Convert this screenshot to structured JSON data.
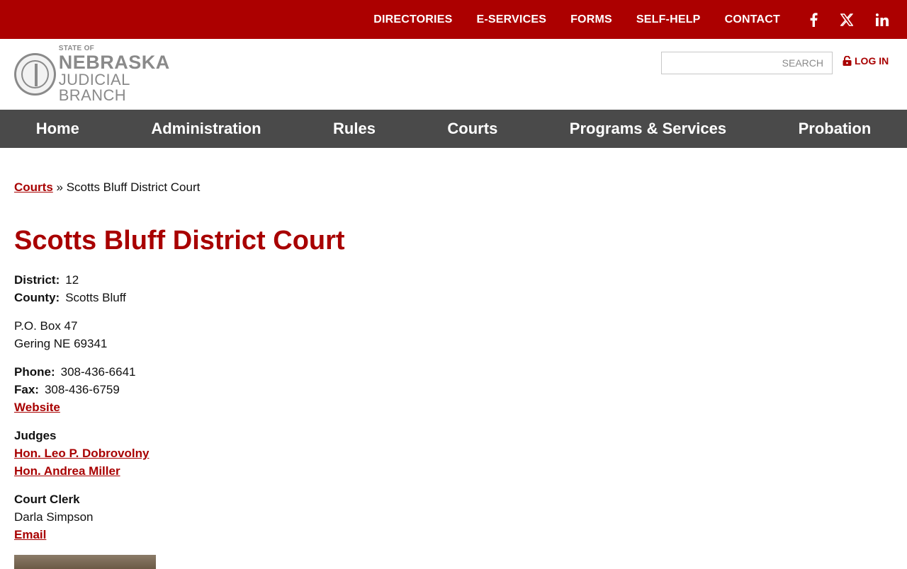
{
  "topnav": {
    "items": [
      "DIRECTORIES",
      "E-SERVICES",
      "FORMS",
      "SELF-HELP",
      "CONTACT"
    ]
  },
  "social": [
    "facebook-icon",
    "x-icon",
    "linkedin-icon"
  ],
  "logo": {
    "line1": "STATE OF",
    "line2": "NEBRASKA",
    "line3": "JUDICIAL BRANCH"
  },
  "search": {
    "placeholder": "SEARCH"
  },
  "login": {
    "label": "LOG IN"
  },
  "mainnav": {
    "items": [
      "Home",
      "Administration",
      "Rules",
      "Courts",
      "Programs & Services",
      "Probation"
    ]
  },
  "breadcrumb": {
    "link": "Courts",
    "separator": "»",
    "current": "Scotts Bluff District Court"
  },
  "page": {
    "title": "Scotts Bluff District Court",
    "district_label": "District:",
    "district": "12",
    "county_label": "County:",
    "county": "Scotts Bluff",
    "address1": "P.O. Box 47",
    "address2": "Gering NE 69341",
    "phone_label": "Phone:",
    "phone": "308-436-6641",
    "fax_label": "Fax:",
    "fax": "308-436-6759",
    "website": "Website",
    "judges_heading": "Judges",
    "judges": [
      "Hon. Leo P. Dobrovolny",
      "Hon. Andrea Miller"
    ],
    "clerk_heading": "Court Clerk",
    "clerk": "Darla Simpson",
    "email": "Email"
  },
  "colors": {
    "brand_red": "#ac0000",
    "nav_gray": "#4a4a4a"
  }
}
